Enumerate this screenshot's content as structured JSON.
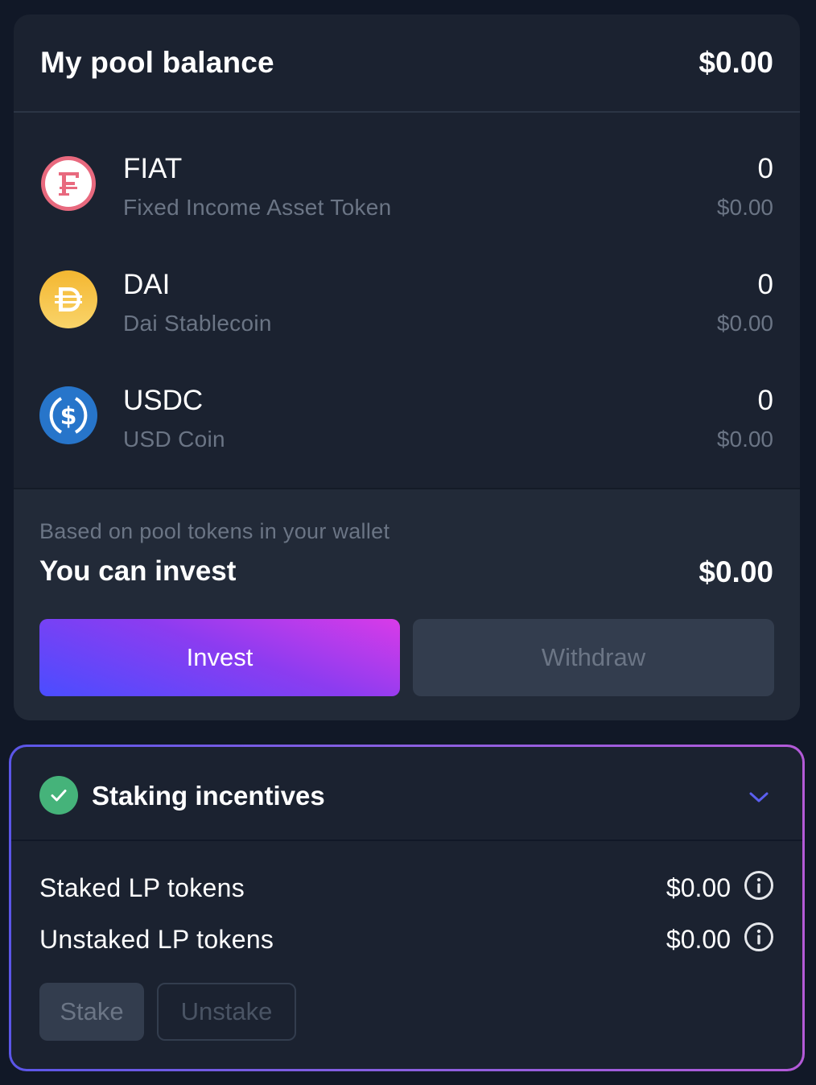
{
  "pool": {
    "title": "My pool balance",
    "total": "$0.00",
    "tokens": [
      {
        "symbol": "FIAT",
        "name": "Fixed Income Asset Token",
        "amount": "0",
        "usd": "$0.00",
        "icon": "fiat-icon",
        "color": "#e8697e"
      },
      {
        "symbol": "DAI",
        "name": "Dai Stablecoin",
        "amount": "0",
        "usd": "$0.00",
        "icon": "dai-icon",
        "color": "#f4b731"
      },
      {
        "symbol": "USDC",
        "name": "USD Coin",
        "amount": "0",
        "usd": "$0.00",
        "icon": "usdc-icon",
        "color": "#2775ca"
      }
    ],
    "invest_note": "Based on pool tokens in your wallet",
    "invest_label": "You can invest",
    "invest_value": "$0.00",
    "invest_button": "Invest",
    "withdraw_button": "Withdraw"
  },
  "staking": {
    "title": "Staking incentives",
    "rows": [
      {
        "label": "Staked LP tokens",
        "value": "$0.00"
      },
      {
        "label": "Unstaked LP tokens",
        "value": "$0.00"
      }
    ],
    "stake_button": "Stake",
    "unstake_button": "Unstake"
  },
  "colors": {
    "background": "#111827",
    "card": "#1b2230",
    "accent_gradient_start": "#4a4dff",
    "accent_gradient_end": "#d93be8",
    "success": "#45b37a",
    "muted_text": "#6b7585"
  }
}
